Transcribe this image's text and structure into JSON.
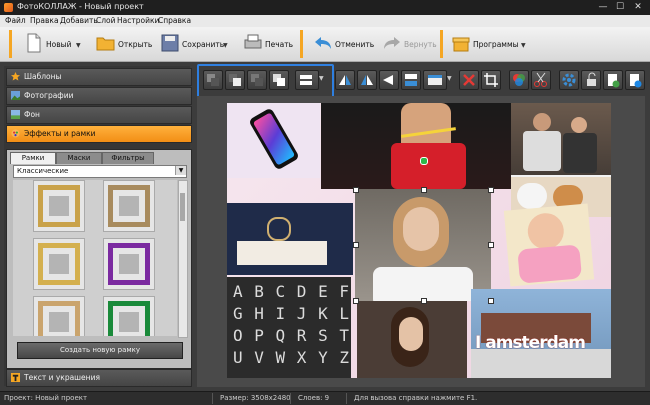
{
  "window": {
    "title": "ФотоКОЛЛАЖ - Новый проект",
    "controls": {
      "minimize": "—",
      "maximize": "☐",
      "close": "✕"
    }
  },
  "menu": {
    "items": [
      "Файл",
      "Правка",
      "Добавить",
      "Слой",
      "Настройки",
      "Справка"
    ]
  },
  "toolbar": {
    "new_label": "Новый",
    "open_label": "Открыть",
    "save_label": "Сохранить",
    "print_label": "Печать",
    "undo_label": "Отменить",
    "redo_label": "Вернуть",
    "programs_label": "Программы",
    "accent_color": "#f5a623"
  },
  "sidebar": {
    "sections": [
      {
        "label": "Шаблоны",
        "icon": "star-icon"
      },
      {
        "label": "Фотографии",
        "icon": "photo-icon"
      },
      {
        "label": "Фон",
        "icon": "background-icon"
      },
      {
        "label": "Эффекты и рамки",
        "icon": "effects-icon",
        "active": true
      }
    ],
    "bottom_section": {
      "label": "Текст и украшения",
      "icon": "text-icon"
    },
    "tabs": [
      "Рамки",
      "Маски",
      "Фильтры"
    ],
    "active_tab": "Рамки",
    "frame_category": "Классические",
    "create_frame_label": "Создать новую рамку",
    "active_color": "#f28e15",
    "frame_colors": [
      "#c9a24a",
      "#a88b5e",
      "#d4b04f",
      "#7b2aa0",
      "#caa46d",
      "#1a8a3a"
    ]
  },
  "edit_tools": {
    "highlight_color": "#2e7fe0",
    "icons": [
      "send-backward-icon",
      "bring-forward-icon",
      "send-to-back-icon",
      "bring-to-front-icon",
      "align-icon",
      "flip-left-icon",
      "flip-right-icon",
      "flip-horizontal-icon",
      "layout-icon",
      "delete-icon",
      "crop-icon",
      "color-icon",
      "cut-icon",
      "settings-icon",
      "lock-icon",
      "add-page-icon",
      "export-icon"
    ]
  },
  "canvas": {
    "collage_text": "I amsterdam",
    "letters": "A B C D E F\nG H I J K L\nO P Q R S T\nU V W X Y Z"
  },
  "status": {
    "project": "Проект:  Новый проект",
    "size": "Размер:  3508x2480",
    "layers": "Слоев:  9",
    "help": "Для вызова справки нажмите F1."
  }
}
